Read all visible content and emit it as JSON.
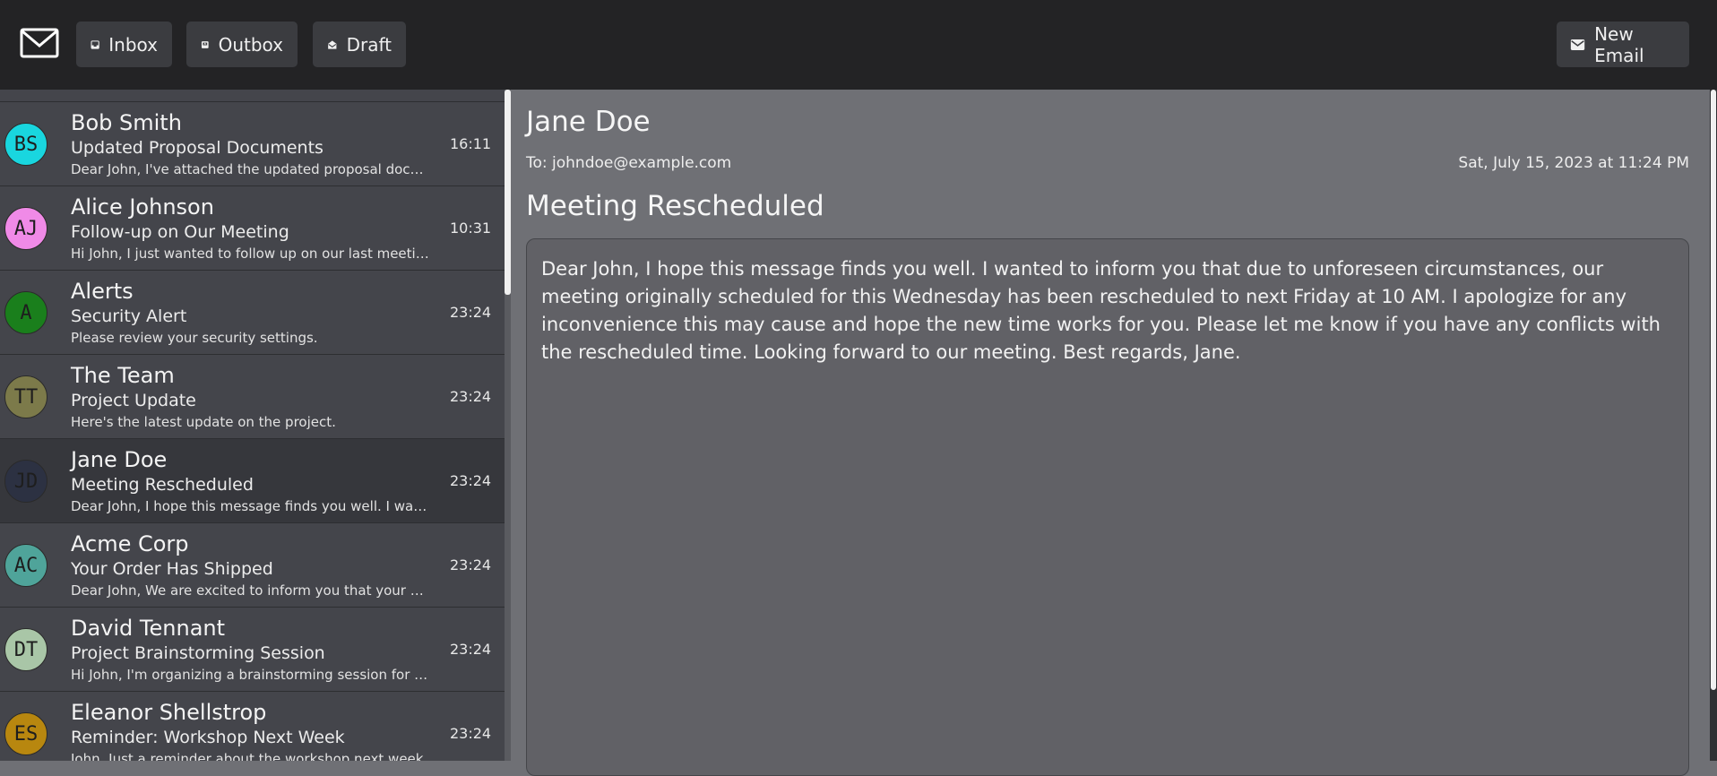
{
  "topbar": {
    "inbox_label": "Inbox",
    "outbox_label": "Outbox",
    "draft_label": "Draft",
    "new_email_label": "New Email"
  },
  "emails": [
    {
      "initials": "",
      "sender": "",
      "subject": "",
      "preview": "",
      "time": "",
      "avatar_color": "#6a2137"
    },
    {
      "initials": "BS",
      "sender": "Bob Smith",
      "subject": "Updated Proposal Documents",
      "preview": "Dear John, I've attached the updated proposal documents for your review.",
      "time": "16:11",
      "avatar_color": "#19d6df"
    },
    {
      "initials": "AJ",
      "sender": "Alice Johnson",
      "subject": "Follow-up on Our Meeting",
      "preview": "Hi John, I just wanted to follow up on our last meeting.",
      "time": "10:31",
      "avatar_color": "#f08ae7"
    },
    {
      "initials": "A",
      "sender": "Alerts",
      "subject": "Security Alert",
      "preview": "Please review your security settings.",
      "time": "23:24",
      "avatar_color": "#1a7f1c"
    },
    {
      "initials": "TT",
      "sender": "The Team",
      "subject": "Project Update",
      "preview": "Here's the latest update on the project.",
      "time": "23:24",
      "avatar_color": "#7c7a4a"
    },
    {
      "initials": "JD",
      "sender": "Jane Doe",
      "subject": "Meeting Rescheduled",
      "preview": "Dear John, I hope this message finds you well. I wanted to inform you",
      "time": "23:24",
      "avatar_color": "#2c3142"
    },
    {
      "initials": "AC",
      "sender": "Acme Corp",
      "subject": "Your Order Has Shipped",
      "preview": "Dear John, We are excited to inform you that your order has shipped.",
      "time": "23:24",
      "avatar_color": "#4fa49a"
    },
    {
      "initials": "DT",
      "sender": "David Tennant",
      "subject": "Project Brainstorming Session",
      "preview": "Hi John, I'm organizing a brainstorming session for the project.",
      "time": "23:24",
      "avatar_color": "#a9c6a7"
    },
    {
      "initials": "ES",
      "sender": "Eleanor Shellstrop",
      "subject": "Reminder: Workshop Next Week",
      "preview": "John, Just a reminder about the workshop next week.",
      "time": "23:24",
      "avatar_color": "#b8870f"
    }
  ],
  "selected_email": {
    "sender": "Jane Doe",
    "to": "To: johndoe@example.com",
    "date": "Sat, July 15, 2023 at 11:24 PM",
    "subject": "Meeting Rescheduled",
    "body": "Dear John, I hope this message finds you well. I wanted to inform you that due to unforeseen circumstances, our meeting originally scheduled for this Wednesday has been rescheduled to next Friday at 10 AM. I apologize for any inconvenience this may cause and hope the new time works for you. Please let me know if you have any conflicts with the rescheduled time. Looking forward to our meeting. Best regards, Jane."
  },
  "icons": {
    "logo": "mail-icon",
    "inbox": "inbox-icon",
    "outbox": "outbox-icon",
    "draft": "draft-icon",
    "new_email": "mail-icon"
  }
}
